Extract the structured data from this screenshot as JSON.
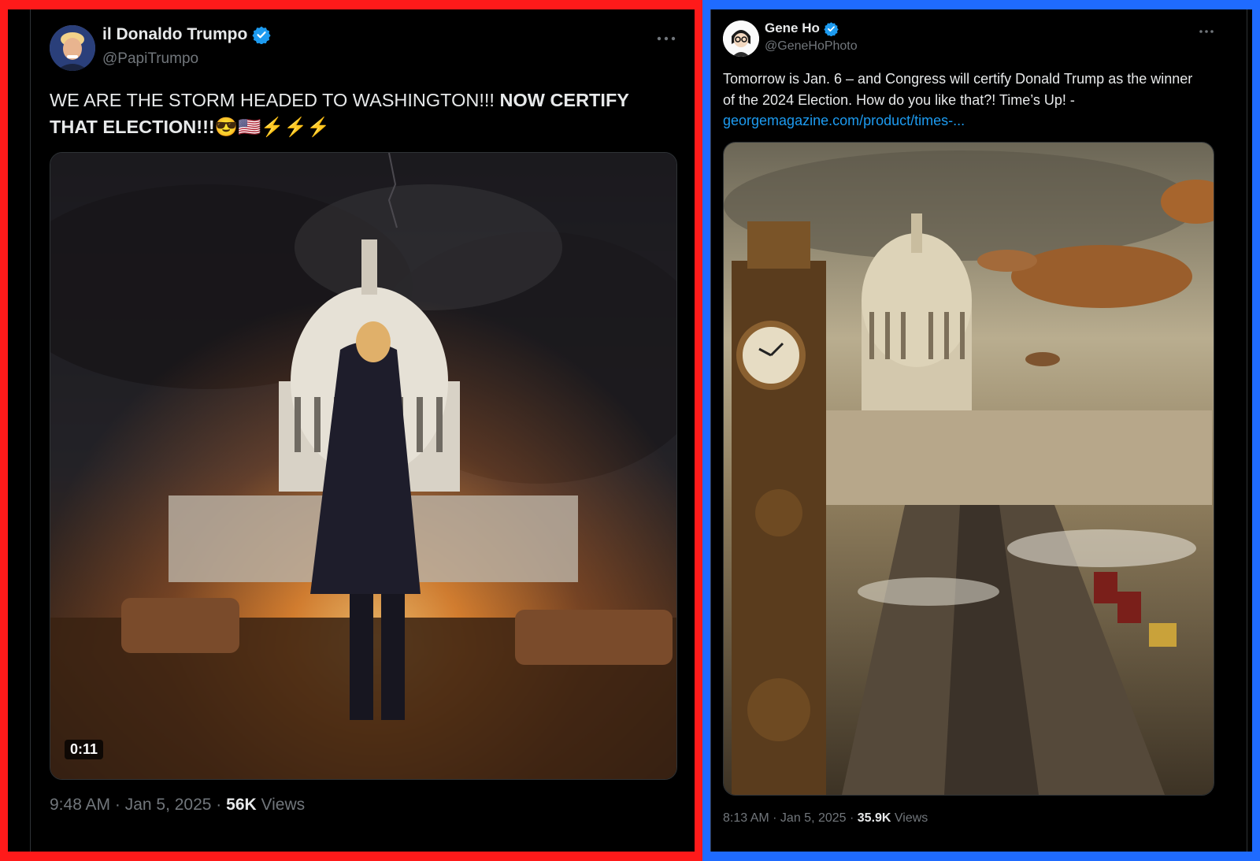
{
  "left_tweet": {
    "display_name": "il Donaldo Trumpo",
    "handle": "@PapiTrumpo",
    "text_regular": "WE ARE THE STORM HEADED TO WASHINGTON!!! ",
    "text_bold": "NOW CERTIFY THAT ELECTION!!!",
    "emojis": "😎🇺🇸⚡⚡⚡",
    "video_duration": "0:11",
    "timestamp": "9:48 AM · Jan 5, 2025 · ",
    "views_count": "56K",
    "views_label": " Views",
    "more_icon": "more-horizontal-icon",
    "accent_border": "#ff1a1a"
  },
  "right_tweet": {
    "display_name": "Gene Ho",
    "handle": "@GeneHoPhoto",
    "text": "Tomorrow is Jan. 6 – and Congress will certify Donald Trump as the winner of the 2024 Election. How do you like that?! Time’s Up! -",
    "link": "georgemagazine.com/product/times-...",
    "timestamp": "8:13 AM · Jan 5, 2025 · ",
    "views_count": "35.9K",
    "views_label": " Views",
    "more_icon": "more-horizontal-icon",
    "accent_border": "#1f6bff"
  },
  "colors": {
    "link": "#1d9bf0",
    "verified": "#1d9bf0",
    "muted_text": "#71767b"
  }
}
